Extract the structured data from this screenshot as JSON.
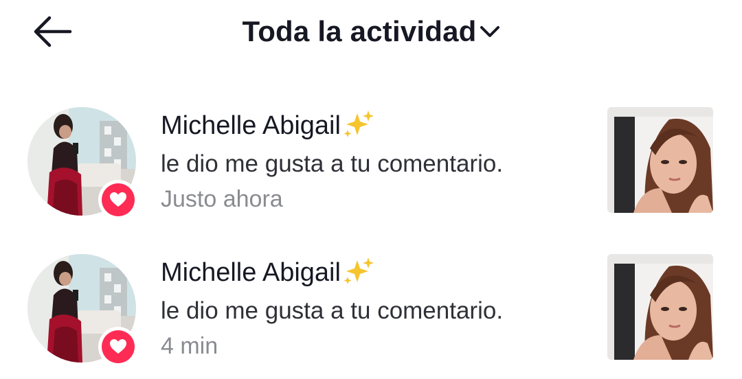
{
  "header": {
    "title": "Toda la actividad"
  },
  "notifications": [
    {
      "user_name": "Michelle Abigail",
      "name_emoji": "sparkles-icon",
      "action": "le dio me gusta a tu comentario.",
      "time": "Justo ahora",
      "badge": "heart-icon"
    },
    {
      "user_name": "Michelle Abigail",
      "name_emoji": "sparkles-icon",
      "action": "le dio me gusta a tu comentario.",
      "time": "4 min",
      "badge": "heart-icon"
    }
  ],
  "colors": {
    "accent": "#fe2c55",
    "text_primary": "#161823",
    "text_secondary": "#8a8b91",
    "sparkle": "#f6c42c"
  }
}
